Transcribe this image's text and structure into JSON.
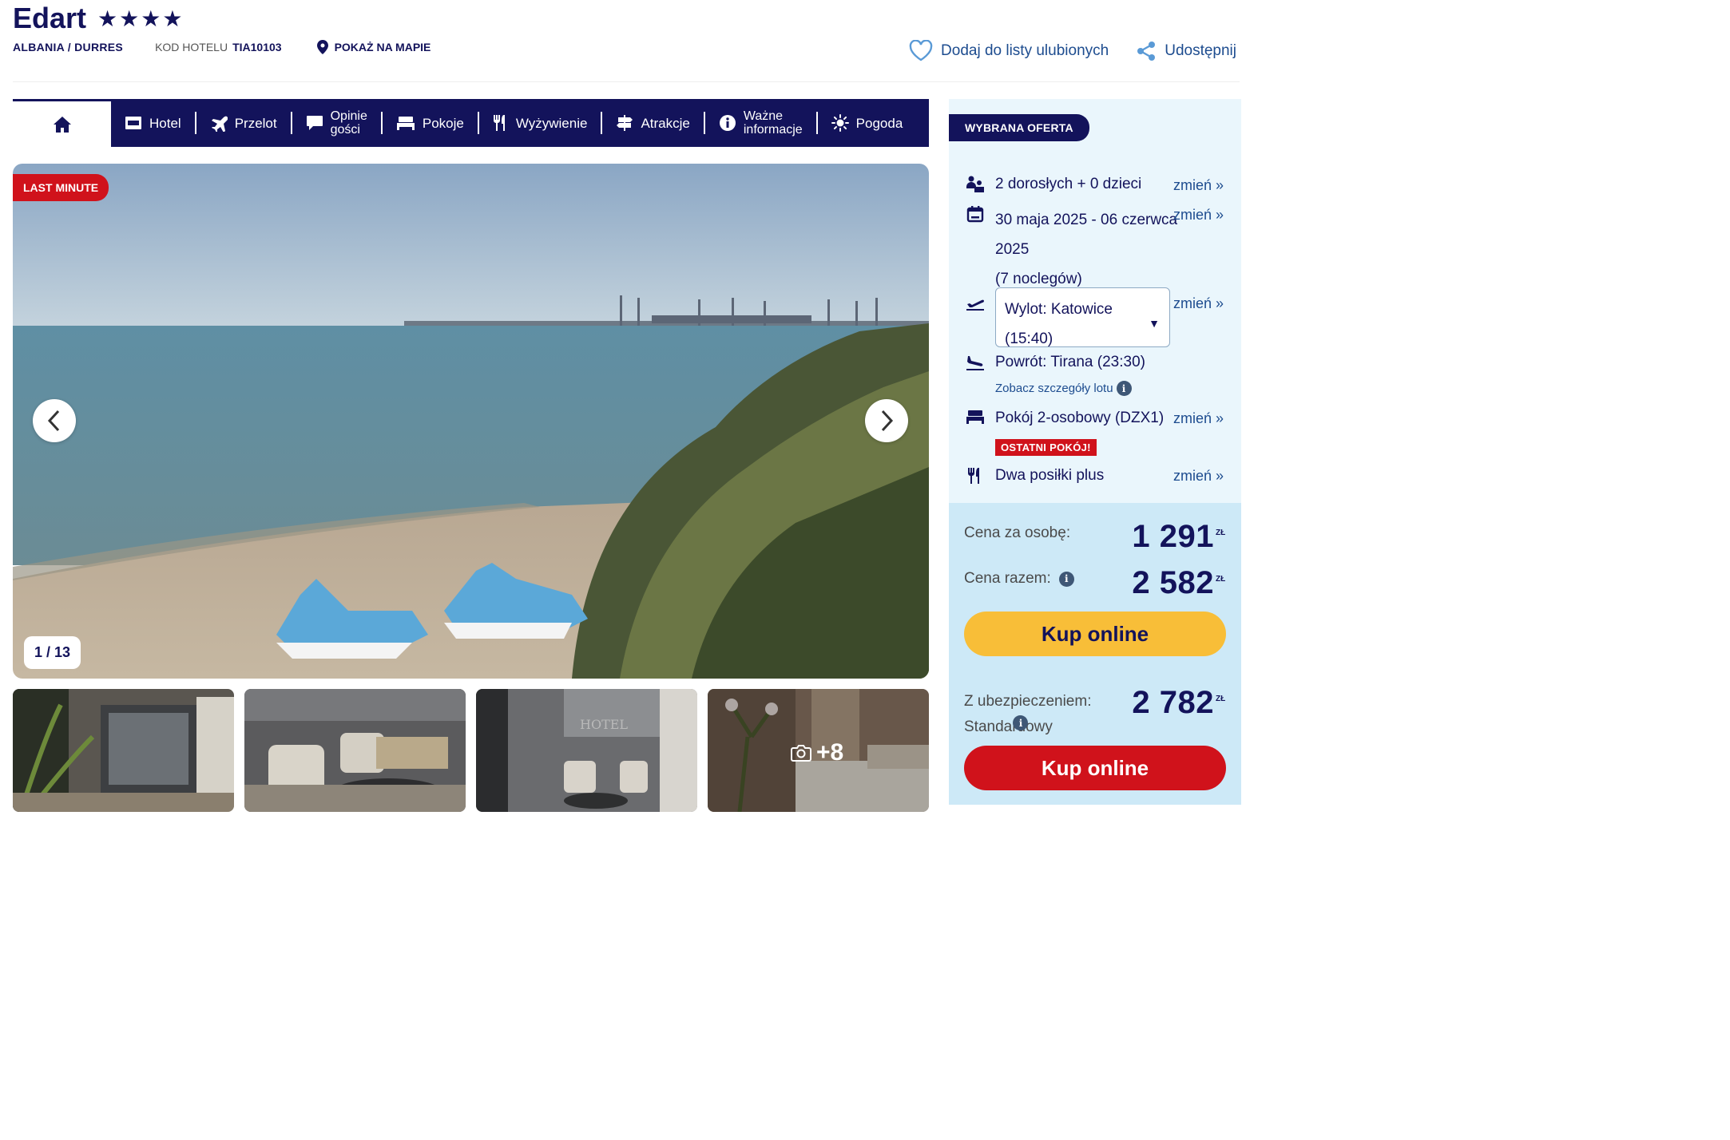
{
  "hotel": {
    "name": "Edart",
    "stars": "★★★★",
    "location": "ALBANIA / DURRES",
    "code_label": "KOD HOTELU",
    "code": "TIA10103",
    "map_link": "POKAŻ NA MAPIE",
    "favorite": "Dodaj do listy ulubionych",
    "share": "Udostępnij"
  },
  "nav": {
    "home_icon": "home-icon",
    "items": [
      {
        "label": "Hotel",
        "icon": "hotel-icon"
      },
      {
        "label": "Przelot",
        "icon": "plane-icon"
      },
      {
        "label_line1": "Opinie",
        "label_line2": "gości",
        "icon": "comment-icon"
      },
      {
        "label": "Pokoje",
        "icon": "bed-icon"
      },
      {
        "label": "Wyżywienie",
        "icon": "cutlery-icon"
      },
      {
        "label": "Atrakcje",
        "icon": "signpost-icon"
      },
      {
        "label_line1": "Ważne",
        "label_line2": "informacje",
        "icon": "info-icon"
      },
      {
        "label": "Pogoda",
        "icon": "sun-icon"
      }
    ]
  },
  "gallery": {
    "badge": "LAST MINUTE",
    "counter": "1 / 13",
    "more": "+8",
    "thumbnails": [
      "lobby-entrance",
      "lobby-armchairs",
      "lobby-reception",
      "hotel-room"
    ]
  },
  "offer": {
    "tag": "WYBRANA OFERTA",
    "change_label": "zmień »",
    "guests": "2 dorosłych + 0 dzieci",
    "dates_line1": "30 maja 2025 - 06 czerwca",
    "dates_line2": "2025",
    "nights": "(7 noclegów)",
    "departure_line1": "Wylot: Katowice",
    "departure_line2": "(15:40)",
    "return": "Powrót: Tirana (23:30)",
    "flight_details": "Zobacz szczegóły lotu",
    "room": "Pokój 2-osobowy (DZX1)",
    "last_room": "OSTATNI POKÓJ!",
    "board": "Dwa posiłki plus"
  },
  "price": {
    "per_person_label": "Cena za osobę:",
    "per_person": "1 291",
    "total_label": "Cena razem:",
    "total": "2 582",
    "currency": "ZŁ",
    "buy": "Kup online",
    "insurance_label_line1": "Z ubezpieczeniem:",
    "insurance_label_line2": "Standardowy",
    "insurance_total": "2 782",
    "buy_insured": "Kup online"
  },
  "colors": {
    "navy": "#13135b",
    "red": "#d0121b",
    "yellow": "#f8be38",
    "link": "#1d4c8f",
    "panel": "#e9f5fb",
    "panel_price": "#cde9f7"
  }
}
